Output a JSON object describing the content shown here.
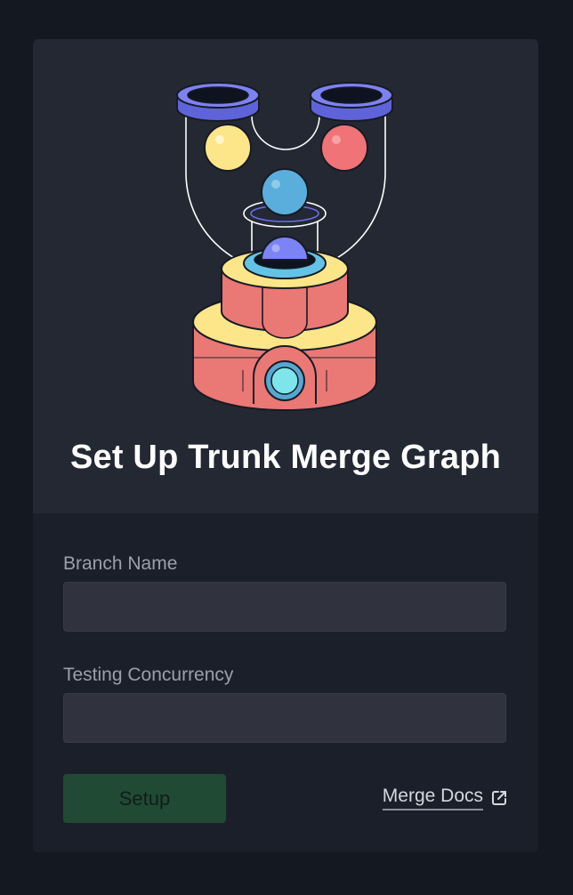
{
  "panel": {
    "title": "Set Up Trunk Merge Graph"
  },
  "form": {
    "branch_label": "Branch Name",
    "branch_value": "",
    "concurrency_label": "Testing Concurrency",
    "concurrency_value": "",
    "setup_label": "Setup",
    "docs_label": "Merge Docs"
  },
  "icons": {
    "docs_link": "external-link-icon"
  },
  "colors": {
    "background": "#141821",
    "card_top": "#242833",
    "card_bottom": "#1b1f2a",
    "input": "#30333d",
    "setup_button": "#214a35"
  }
}
